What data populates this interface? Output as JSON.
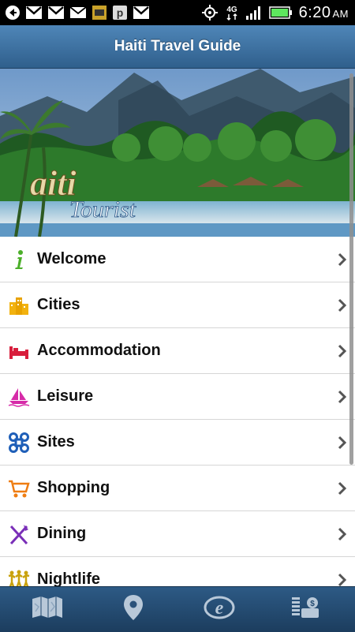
{
  "status_bar": {
    "time": "6:20",
    "ampm": "AM",
    "network": "4G",
    "icons": [
      "back-arrow-icon",
      "gmail-icon",
      "gmail-icon",
      "mail-icon",
      "notification-icon",
      "p-icon",
      "gmail-icon",
      "gps-icon",
      "network-4g-icon",
      "signal-icon",
      "battery-icon"
    ]
  },
  "header": {
    "title": "Haiti Travel Guide"
  },
  "banner": {
    "logo_line1": "aiti",
    "logo_line2": "Tourist"
  },
  "menu": {
    "items": [
      {
        "label": "Welcome",
        "icon": "info-icon"
      },
      {
        "label": "Cities",
        "icon": "buildings-icon"
      },
      {
        "label": "Accommodation",
        "icon": "bed-icon"
      },
      {
        "label": "Leisure",
        "icon": "sailboat-icon"
      },
      {
        "label": "Sites",
        "icon": "command-knot-icon"
      },
      {
        "label": "Shopping",
        "icon": "shopping-cart-icon"
      },
      {
        "label": "Dining",
        "icon": "fork-knife-icon"
      },
      {
        "label": "Nightlife",
        "icon": "dancers-icon"
      }
    ]
  },
  "tabbar": {
    "tabs": [
      "map-icon",
      "location-pin-icon",
      "e-logo-icon",
      "currency-converter-icon"
    ]
  },
  "colors": {
    "header": "#3d6fa0",
    "tabbar": "#244b71",
    "chevron": "#555555"
  }
}
